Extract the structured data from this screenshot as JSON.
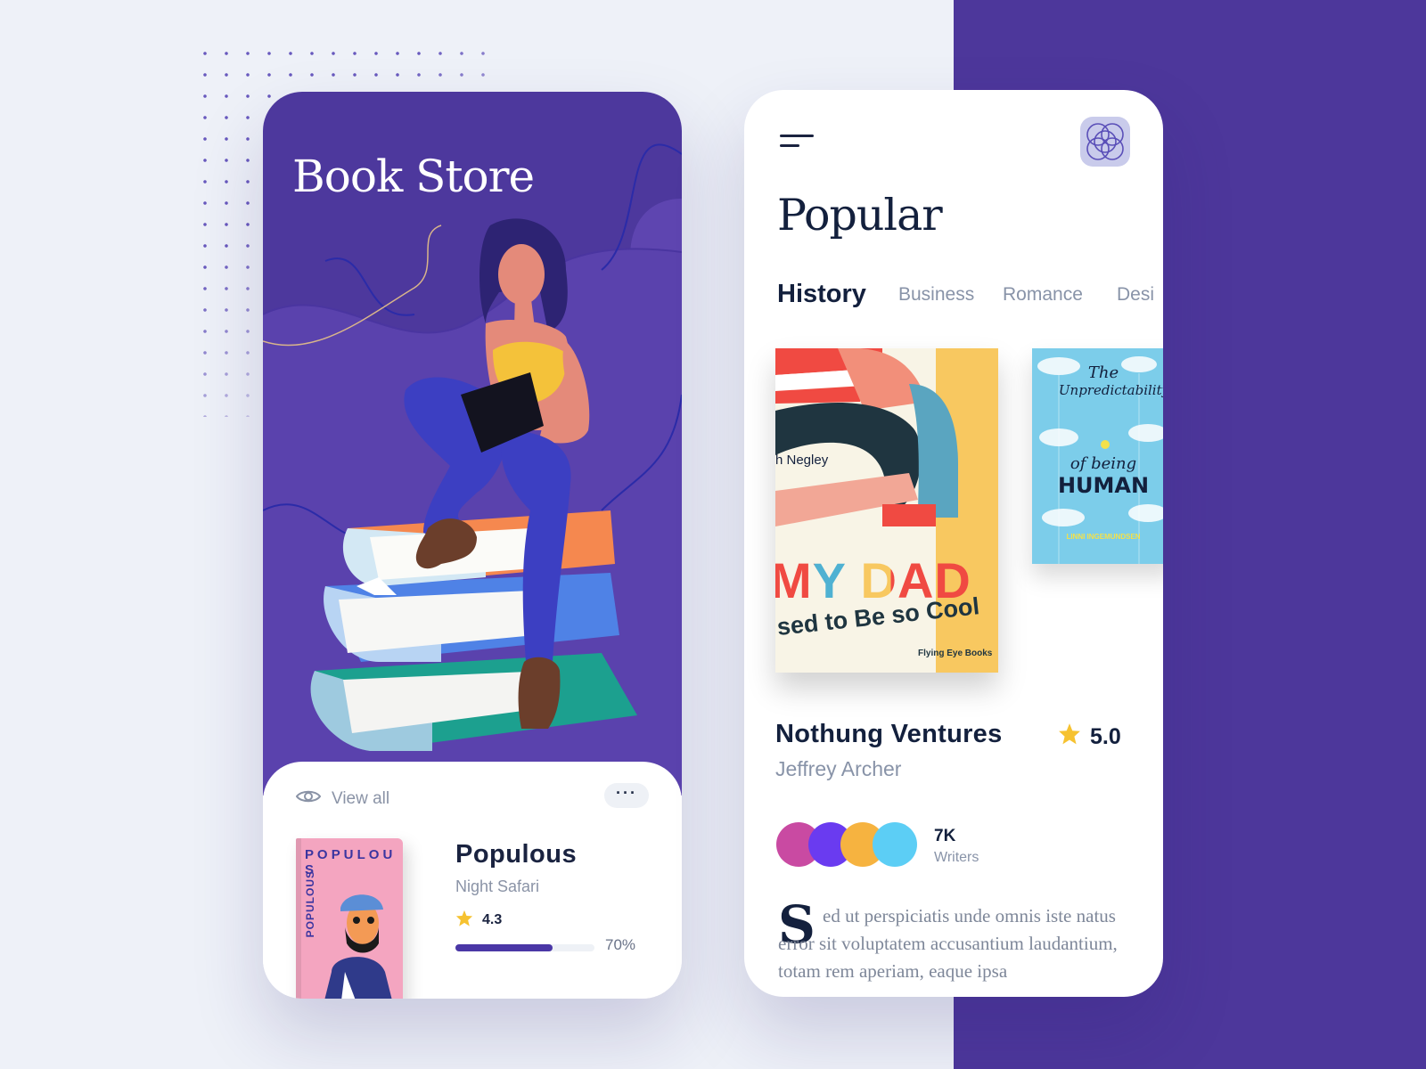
{
  "left_screen": {
    "title": "Book Store",
    "view_all_label": "View all",
    "more_label": "···",
    "current_book": {
      "title": "Populous",
      "subtitle": "Night Safari",
      "rating": "4.3",
      "progress": 0.7,
      "progress_label": "70%",
      "cover_letters": "P O P U L O U S",
      "cover_vertical": "POPULOUS"
    }
  },
  "right_screen": {
    "page_title": "Popular",
    "tabs": [
      "History",
      "Business",
      "Romance",
      "Desi"
    ],
    "active_tab": "History",
    "covers": [
      {
        "name": "my-dad-used-to-be-so-cool",
        "author_text": "h Negley",
        "title_line1": "MY DAD",
        "title_line2": "sed to Be so Cool",
        "publisher": "Flying Eye Books"
      },
      {
        "name": "unpredictability-of-being-human",
        "title_line1": "The",
        "title_line2": "Unpredictability",
        "title_line3": "of being",
        "title_line4": "HUMAN",
        "author": "LINNI INGEMUNDSEN"
      }
    ],
    "featured": {
      "title": "Nothung Ventures",
      "author": "Jeffrey Archer",
      "rating": "5.0",
      "writers_count": "7K",
      "writers_label": "Writers",
      "dropcap": "S",
      "body": "ed ut perspiciatis unde omnis iste natus error sit voluptatem accusantium laudantium, totam rem aperiam, eaque ipsa"
    }
  },
  "colors": {
    "purple": "#4d379b",
    "navy": "#13203d",
    "grey_text": "#8893a8",
    "star": "#f6c230",
    "writer_avatars": [
      "#c94aa2",
      "#6a3bf0",
      "#f6b340",
      "#5ccef5"
    ]
  }
}
